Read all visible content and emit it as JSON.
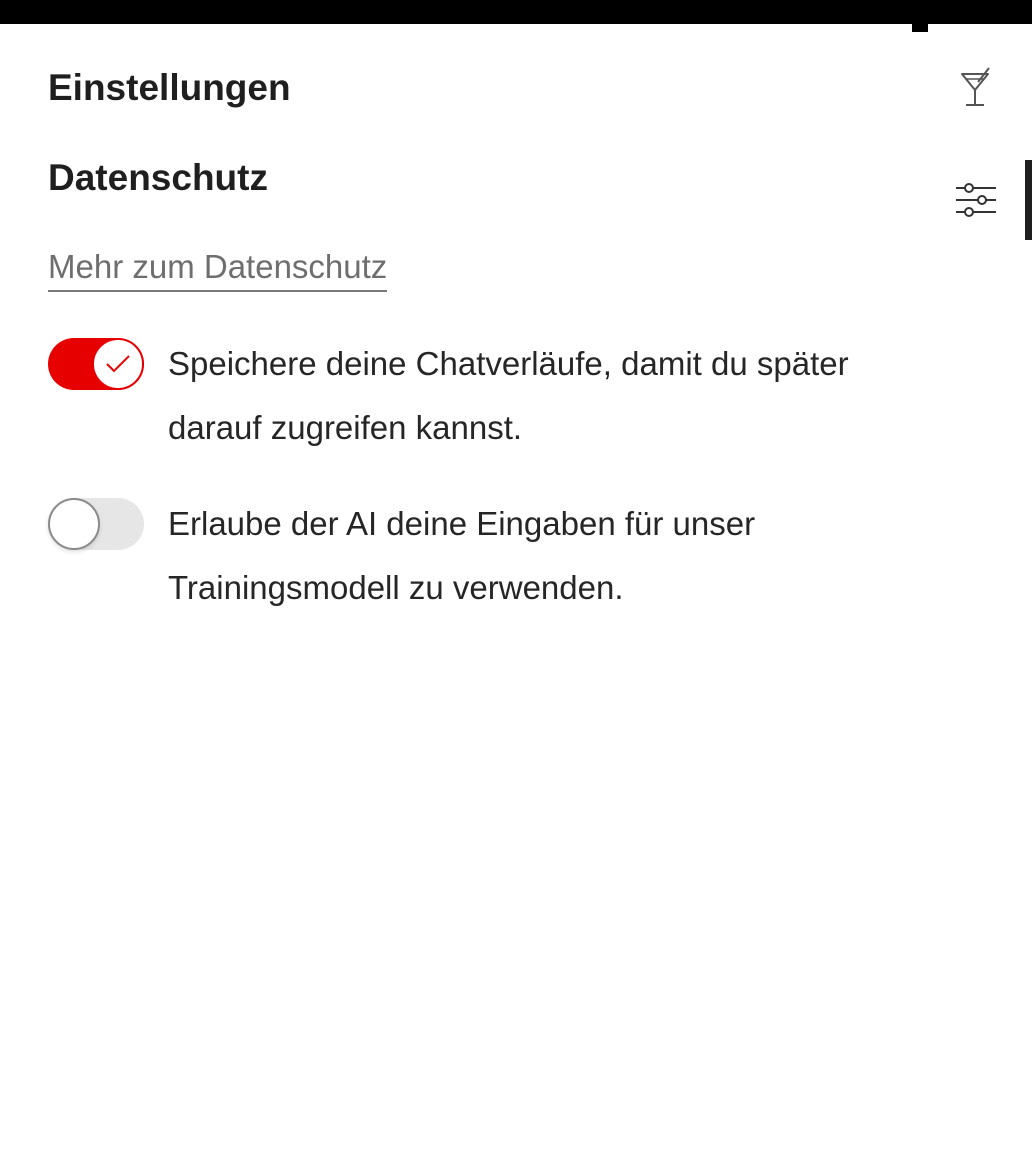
{
  "header": {
    "title": "Einstellungen"
  },
  "privacy": {
    "section_title": "Datenschutz",
    "link_label": "Mehr zum Datenschutz"
  },
  "settings": [
    {
      "label": "Speichere deine Chatverläufe, damit du später darauf zugreifen kannst.",
      "enabled": true
    },
    {
      "label": "Erlaube der AI deine Eingaben für unser Trainingsmodell zu verwenden.",
      "enabled": false
    }
  ],
  "side_rail": {
    "items": [
      {
        "icon": "cocktail-glass-icon"
      },
      {
        "icon": "sliders-icon",
        "active": true
      }
    ]
  },
  "colors": {
    "accent": "#e60000",
    "text": "#1f1f1f",
    "link": "#6e6e6e",
    "toggle_off": "#e6e6e6"
  }
}
